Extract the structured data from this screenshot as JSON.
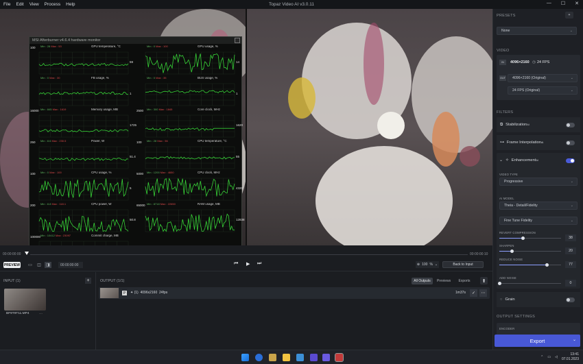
{
  "menubar": {
    "items": [
      "File",
      "Edit",
      "View",
      "Process",
      "Help"
    ],
    "title": "Topaz Video AI  v3.0.11",
    "controls": {
      "minimize": "—",
      "maximize": "☐",
      "close": "✕"
    }
  },
  "msi": {
    "title": "MSI Afterburner v4.6.4 hardware monitor",
    "graphs": [
      {
        "label": "GPU temperature, °C",
        "min": "Min : 28",
        "max": "Max : 53",
        "top": "100",
        "cur": "59"
      },
      {
        "label": "GPU usage, %",
        "min": "Min : 0",
        "max": "Max : 100",
        "top": "",
        "cur": "14"
      },
      {
        "label": "FB usage, %",
        "min": "Min : 0",
        "max": "Max : 30",
        "top": "",
        "cur": "1"
      },
      {
        "label": "BUS usage, %",
        "min": "Min : 0",
        "max": "Max : 35",
        "top": "",
        "cur": "1"
      },
      {
        "label": "Memory usage, MB",
        "min": "Min : 845",
        "max": "Max : 1619",
        "top": "16000",
        "cur": "1725"
      },
      {
        "label": "Core clock, MHz",
        "min": "Min : 300",
        "max": "Max : 1845",
        "top": "2500",
        "cur": "1620"
      },
      {
        "label": "Power, W",
        "min": "Min : 8.6",
        "max": "Max : 230.5",
        "top": "250",
        "cur": "51.4"
      },
      {
        "label": "CPU temperature, °C",
        "min": "Min : 28",
        "max": "Max : 56",
        "top": "100",
        "cur": "55"
      },
      {
        "label": "CPU usage, %",
        "min": "Min : 0",
        "max": "Max : 100",
        "top": "100",
        "cur": "5"
      },
      {
        "label": "CPU clock, MHz",
        "min": "Min : 1200",
        "max": "Max : 4650",
        "top": "5000",
        "cur": "4320"
      },
      {
        "label": "CPU power, W",
        "min": "Min : 8.8",
        "max": "Max : 118.1",
        "top": "200",
        "cur": "50.8"
      },
      {
        "label": "RAM usage, MB",
        "min": "Min : 8718",
        "max": "Max : 22650",
        "top": "65000",
        "cur": "12838"
      },
      {
        "label": "Commit charge, MB",
        "min": "Min : 10412",
        "max": "Max : 23097",
        "top": "100000",
        "cur": "15510"
      }
    ]
  },
  "timeline": {
    "start": "00:00:00:00",
    "end": "00:00:00:10"
  },
  "controls": {
    "preview": "PREVIEW",
    "timecode": "00:00:00:00",
    "zoom": "100",
    "zoom_unit": "%",
    "back_to_input": "Back to Input"
  },
  "input": {
    "header": "INPUT (1)",
    "file": "BF9T9T11.MP4"
  },
  "output": {
    "header": "OUTPUT (1/1)",
    "tabs": [
      "All Outputs",
      "Previews",
      "Exports"
    ],
    "row": {
      "count": "(1)",
      "resolution": "4096x2160",
      "fps": "24fps",
      "time": "1m37s"
    }
  },
  "presets": {
    "header": "PRESETS",
    "value": "None"
  },
  "video": {
    "header": "VIDEO",
    "in_tag": "IN",
    "in_res": "4096×2160",
    "in_fps": "24 FPS",
    "out_tag": "OUT",
    "out_res": "4096×2160 (Original)",
    "out_fps": "24 FPS (Original)"
  },
  "filters": {
    "header": "FILTERS",
    "stabilization": "Stabilization",
    "frame_interp": "Frame Interpolation",
    "enhancement": "Enhancement",
    "ai_sup": "AI",
    "video_type_label": "VIDEO TYPE",
    "video_type": "Progressive",
    "ai_model_label": "AI MODEL",
    "ai_model": "Theia - Detail/Fidelity",
    "ai_mode": "Fine Tune Fidelity",
    "revert_label": "REVERT COMPRESSION",
    "revert_value": 38,
    "sharpen_label": "SHARPEN",
    "sharpen_value": 20,
    "noise_label": "REDUCE NOISE",
    "noise_value": 77,
    "addnoise_label": "ADD NOISE",
    "addnoise_value": 0,
    "grain": "Grain"
  },
  "output_settings": {
    "header": "OUTPUT SETTINGS",
    "encoder_label": "ENCODER"
  },
  "export": {
    "label": "Export"
  },
  "taskbar": {
    "time": "13:41",
    "date": "07.01.2023"
  },
  "colors": {
    "accent": "#4858d6",
    "graph": "#37d337",
    "msi_bg": "#0c0d0c"
  }
}
